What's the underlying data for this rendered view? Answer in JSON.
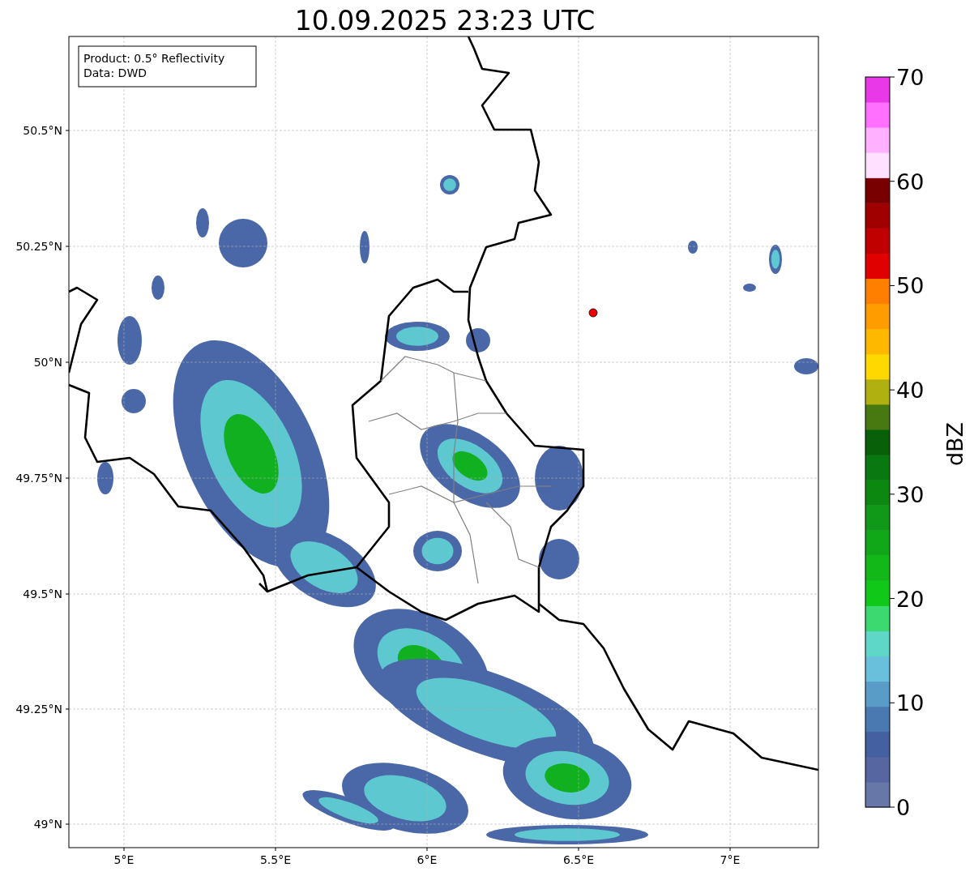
{
  "title": "10.09.2025 23:23 UTC",
  "info_box": {
    "lines": [
      "Product: 0.5° Reflectivity",
      "Data: DWD"
    ]
  },
  "map": {
    "yticks": [
      "50.5°N",
      "50.25°N",
      "50°N",
      "49.75°N",
      "49.5°N",
      "49.25°N",
      "49°N"
    ],
    "xticks": [
      "5°E",
      "5.5°E",
      "6°E",
      "6.5°E",
      "7°E"
    ]
  },
  "colorbar": {
    "label": "dBZ",
    "ticks": [
      "70",
      "60",
      "50",
      "40",
      "30",
      "20",
      "10",
      "0"
    ],
    "segments": [
      {
        "color": "#6677a8"
      },
      {
        "color": "#5566a0"
      },
      {
        "color": "#4460a0"
      },
      {
        "color": "#4a78b0"
      },
      {
        "color": "#5a9cc8"
      },
      {
        "color": "#68c0dc"
      },
      {
        "color": "#5ed6c8"
      },
      {
        "color": "#3cd870"
      },
      {
        "color": "#10c818"
      },
      {
        "color": "#12b818"
      },
      {
        "color": "#10a818"
      },
      {
        "color": "#109818"
      },
      {
        "color": "#0c8810"
      },
      {
        "color": "#0a7810"
      },
      {
        "color": "#086008"
      },
      {
        "color": "#487810"
      },
      {
        "color": "#b0b010"
      },
      {
        "color": "#ffd800"
      },
      {
        "color": "#ffb800"
      },
      {
        "color": "#ff9c00"
      },
      {
        "color": "#ff8000"
      },
      {
        "color": "#e00000"
      },
      {
        "color": "#c00000"
      },
      {
        "color": "#a00000"
      },
      {
        "color": "#780000"
      },
      {
        "color": "#ffe0ff"
      },
      {
        "color": "#ffb0ff"
      },
      {
        "color": "#ff70ff"
      },
      {
        "color": "#e838e8"
      }
    ]
  }
}
